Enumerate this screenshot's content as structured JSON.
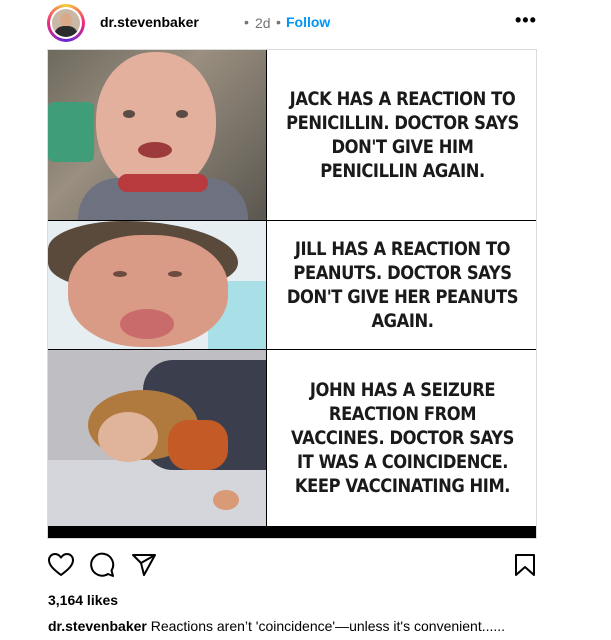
{
  "post": {
    "username": "dr.stevenbaker",
    "dot": "•",
    "time": "2d",
    "follow_label": "Follow",
    "more_label": "•••",
    "panels": [
      {
        "text": "JACK HAS A REACTION TO PENICILLIN. DOCTOR SAYS DON'T GIVE HIM PENICILLIN AGAIN."
      },
      {
        "text": "JILL HAS A REACTION TO PEANUTS. DOCTOR SAYS DON'T GIVE HER PEANUTS AGAIN."
      },
      {
        "text": "JOHN HAS A SEIZURE REACTION FROM VACCINES. DOCTOR SAYS IT WAS A COINCIDENCE. KEEP VACCINATING HIM."
      }
    ],
    "likes": "3,164 likes",
    "caption_user": "dr.stevenbaker",
    "caption_text": "Reactions aren’t 'coincidence'—unless it's convenient......"
  },
  "icons": {
    "like": "heart-icon",
    "comment": "comment-icon",
    "share": "share-icon",
    "save": "bookmark-icon"
  }
}
